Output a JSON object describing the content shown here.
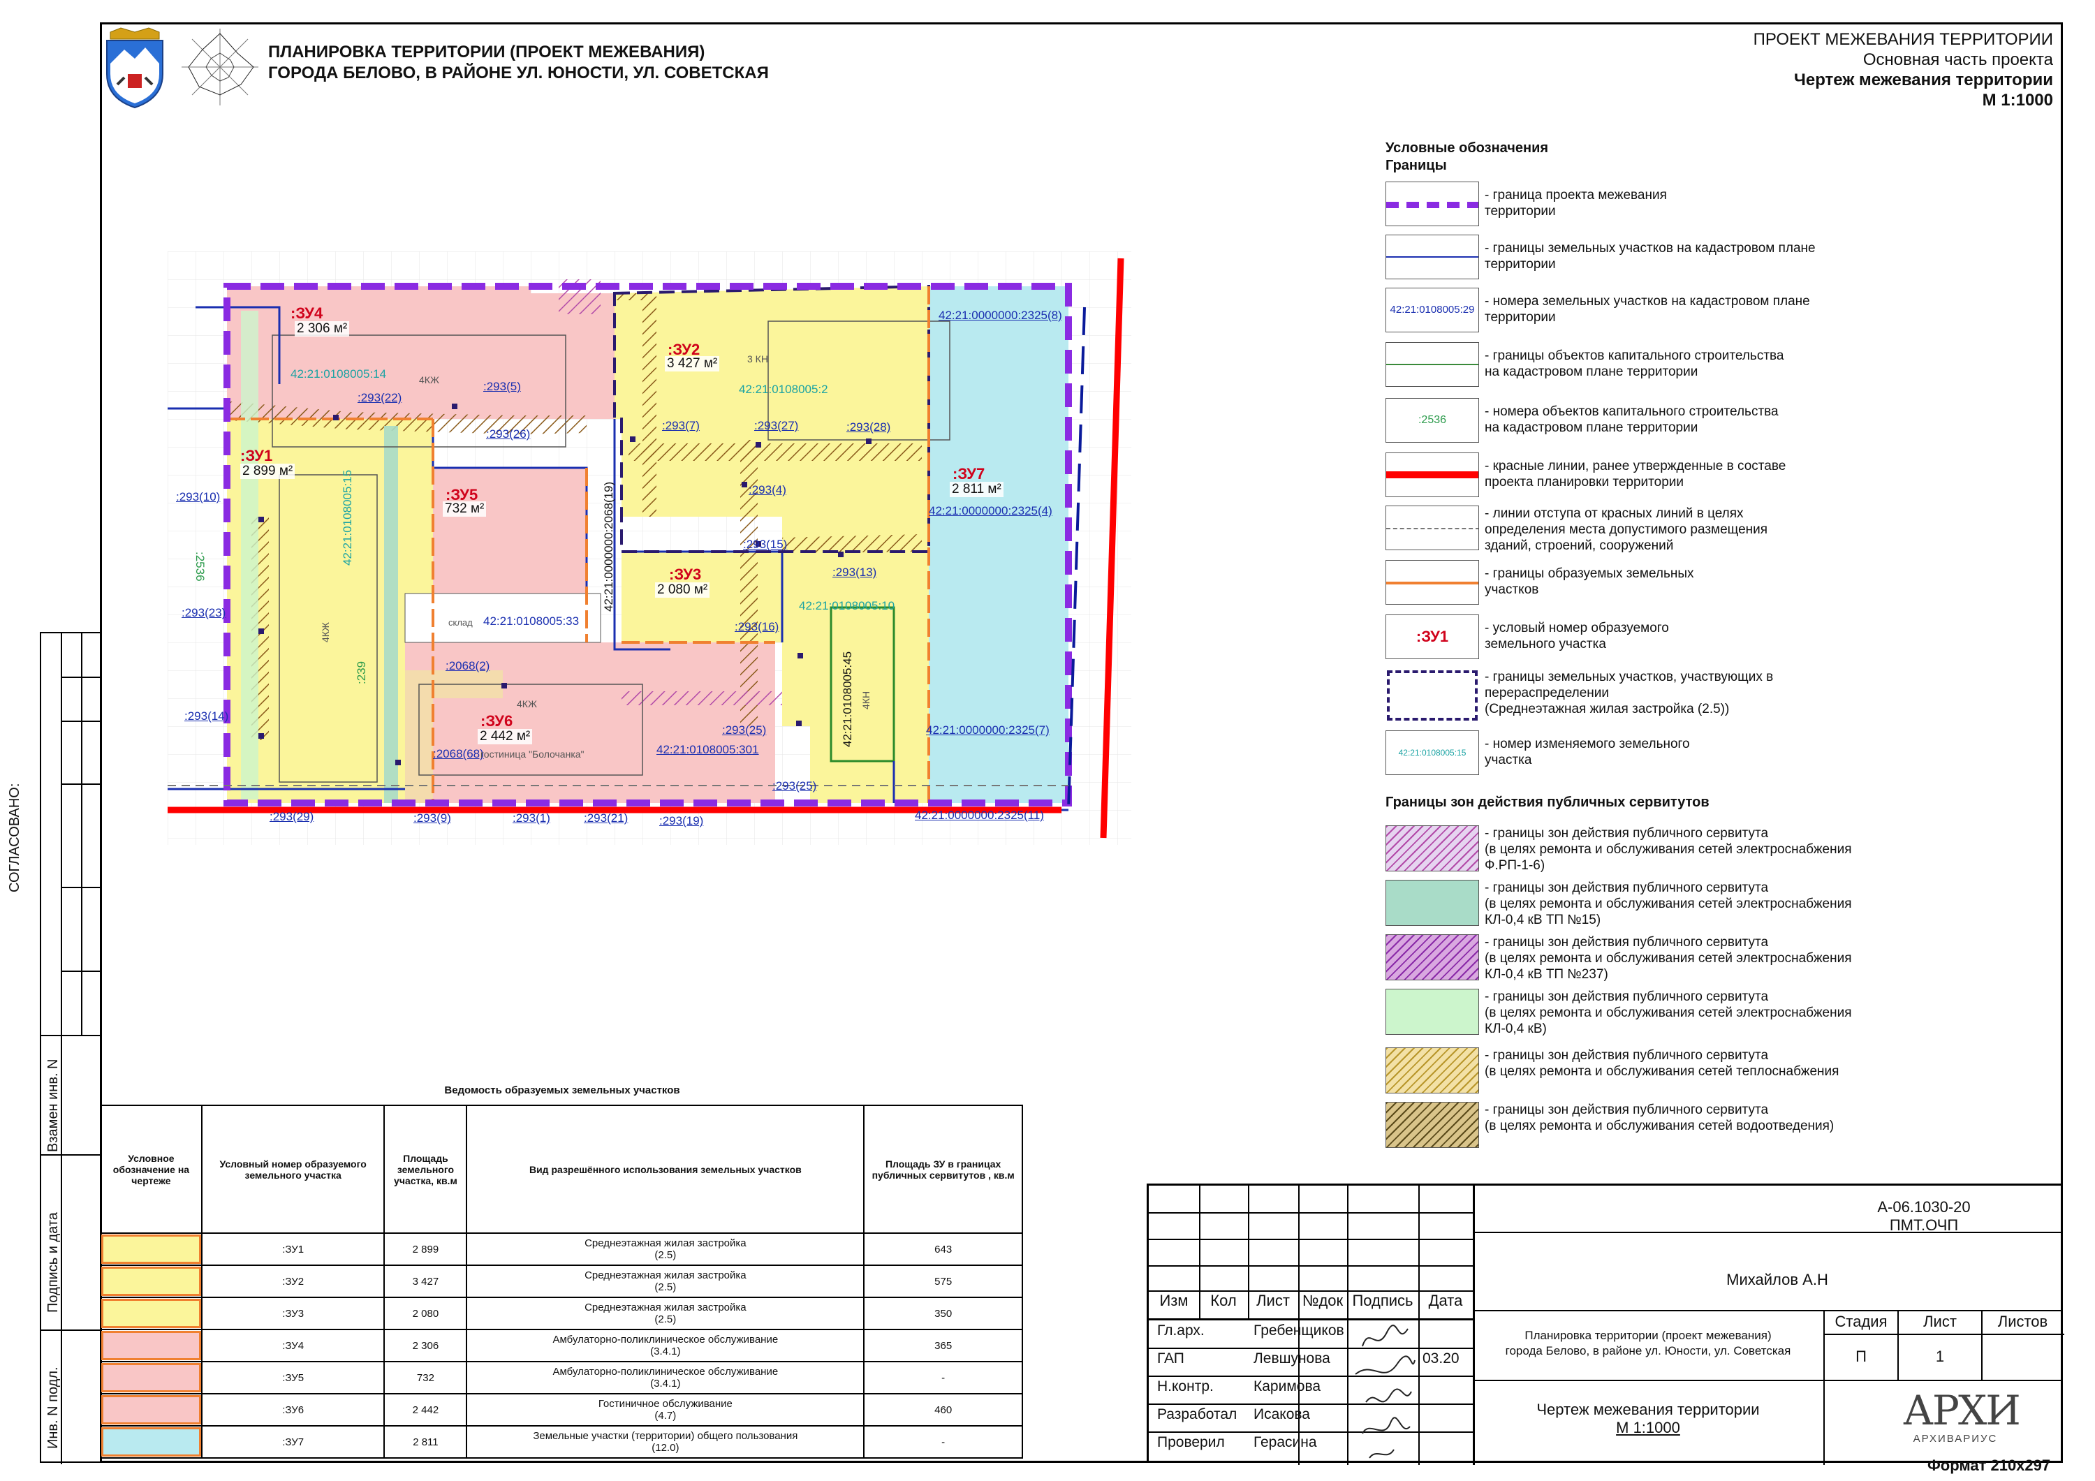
{
  "header": {
    "title_line1": "ПЛАНИРОВКА ТЕРРИТОРИИ (ПРОЕКТ МЕЖЕВАНИЯ)",
    "title_line2": "ГОРОДА БЕЛОВО, В РАЙОНЕ УЛ. ЮНОСТИ, УЛ. СОВЕТСКАЯ"
  },
  "topright": {
    "line1": "ПРОЕКТ МЕЖЕВАНИЯ ТЕРРИТОРИИ",
    "line2": "Основная часть проекта",
    "line3": "Чертеж межевания территории",
    "line4": "М 1:1000"
  },
  "legend": {
    "title1": "Условные обозначения",
    "title2": "Границы",
    "items": [
      {
        "text1": "- граница проекта межевания",
        "text2": "территории"
      },
      {
        "text1": "- границы земельных участков на кадастровом плане",
        "text2": "территории"
      },
      {
        "text1": "- номера земельных участков на кадастровом плане",
        "text2": "территории",
        "sample": "42:21:0108005:29"
      },
      {
        "text1": "- границы объектов капитального строительства",
        "text2": "на кадастровом плане территории"
      },
      {
        "text1": "- номера объектов капитального строительства",
        "text2": "на кадастровом плане территории",
        "sample": ":2536"
      },
      {
        "text1": "- красные линии, ранее утвержденные в составе",
        "text2": "проекта планировки территории"
      },
      {
        "text1": "- линии отступа от красных линий в целях",
        "text2": "определения места допустимого размещения",
        "text3": "зданий, строений, сооружений"
      },
      {
        "text1": " - границы образуемых земельных",
        "text2": " участков"
      },
      {
        "text1": " - условый номер образуемого",
        "text2": " земельного участка",
        "sample": ":ЗУ1"
      },
      {
        "text1": " - границы земельных участков, участвующих в",
        "text2": "перераспределении",
        "text3": "(Среднеэтажная жилая застройка (2.5))"
      },
      {
        "text1": "- номер изменяемого земельного",
        "text2": "участка",
        "sample": "42:21:0108005:15"
      }
    ],
    "servitude_title": "Границы зон действия публичных сервитутов",
    "servitudes": [
      {
        "text1": "- границы зон действия публичного сервитута",
        "text2": "(в целях ремонта и обслуживания сетей электроснабжения",
        "text3": "Ф.РП-1-6)",
        "color": "#e6d4f0"
      },
      {
        "text1": "- границы зон действия публичного сервитута",
        "text2": "(в целях ремонта и обслуживания сетей электроснабжения",
        "text3": "КЛ-0,4 кВ ТП №15)",
        "color": "#a9dcc8"
      },
      {
        "text1": "- границы зон действия публичного сервитута",
        "text2": "(в целях ремонта и обслуживания сетей электроснабжения",
        "text3": "КЛ-0,4 кВ ТП №237)",
        "color": "#d9a8e0"
      },
      {
        "text1": "- границы зон действия публичного сервитута",
        "text2": "(в целях ремонта и обслуживания сетей электроснабжения",
        "text3": "КЛ-0,4 кВ)",
        "color": "#ccf5cc"
      },
      {
        "text1": "- границы зон действия публичного сервитута",
        "text2": "(в целях ремонта и обслуживания сетей теплоснабжения",
        "text3": "",
        "color": "#f3e1a6"
      },
      {
        "text1": "- границы зон действия публичного сервитута",
        "text2": "(в целях ремонта и обслуживания сетей водоотведения)",
        "text3": "",
        "color": "#d9c48a"
      }
    ]
  },
  "map": {
    "zones": [
      {
        "id": ":ЗУ4",
        "area": "2 306 м²"
      },
      {
        "id": ":ЗУ2",
        "area": "3 427 м²"
      },
      {
        "id": ":ЗУ1",
        "area": "2 899 м²"
      },
      {
        "id": ":ЗУ5",
        "area": "732 м²"
      },
      {
        "id": ":ЗУ7",
        "area": "2 811 м²"
      },
      {
        "id": ":ЗУ3",
        "area": "2 080 м²"
      },
      {
        "id": ":ЗУ6",
        "area": "2 442 м²"
      }
    ],
    "cadastral": [
      "42:21:0108005:14",
      "42:21:0108005:2",
      "42:21:0108005:15",
      "42:21:0108005:33",
      "42:21:0108005:10",
      "42:21:0108005:45",
      "42:21:0000000:2068(19)",
      "42:21:0108005:301",
      "42:21:0000000:2325(8)",
      "42:21:0000000:2325(4)",
      "42:21:0000000:2325(7)",
      "42:21:0000000:2325(11)"
    ],
    "servs": [
      ":293(22)",
      ":293(5)",
      ":293(26)",
      ":293(7)",
      ":293(27)",
      ":293(28)",
      ":293(4)",
      ":293(15)",
      ":293(13)",
      ":293(16)",
      ":293(10)",
      ":293(23)",
      ":293(14)",
      ":2068(2)",
      ":2068(68)",
      ":293(25)",
      ":293(25)",
      ":293(29)",
      ":293(9)",
      ":293(1)",
      ":293(21)",
      ":293(19)",
      ":2536",
      ":239"
    ],
    "buildings": [
      "4КЖ",
      "4КЖ",
      "4КЖ",
      "3 КН",
      "4КН",
      "гостиница \"Болочанка\"",
      "склад"
    ]
  },
  "table": {
    "title": "Ведомость образуемых земельных участков",
    "headers": [
      "Условное обозначение на чертеже",
      "Условный номер образуемого земельного участка",
      "Площадь земельного участка, кв.м",
      "Вид разрешённого использования земельных участков",
      "Площадь ЗУ в границах публичных сервитутов , кв.м"
    ],
    "rows": [
      {
        "color": "#fbf59b",
        "num": ":ЗУ1",
        "area": "2 899",
        "use1": "Среднеэтажная жилая застройка",
        "use2": "(2.5)",
        "serv": "643"
      },
      {
        "color": "#fbf59b",
        "num": ":ЗУ2",
        "area": "3 427",
        "use1": "Среднеэтажная жилая застройка",
        "use2": "(2.5)",
        "serv": "575"
      },
      {
        "color": "#fbf59b",
        "num": ":ЗУ3",
        "area": "2 080",
        "use1": "Среднеэтажная жилая застройка",
        "use2": "(2.5)",
        "serv": "350"
      },
      {
        "color": "#f9c6c6",
        "num": ":ЗУ4",
        "area": "2 306",
        "use1": "Амбулаторно-поликлиническое обслуживание",
        "use2": "(3.4.1)",
        "serv": "365"
      },
      {
        "color": "#f9c6c6",
        "num": ":ЗУ5",
        "area": "732",
        "use1": "Амбулаторно-поликлиническое обслуживание",
        "use2": "(3.4.1)",
        "serv": "-"
      },
      {
        "color": "#f9c6c6",
        "num": ":ЗУ6",
        "area": "2 442",
        "use1": "Гостиничное обслуживание",
        "use2": "(4.7)",
        "serv": "460"
      },
      {
        "color": "#b9eaf0",
        "num": ":ЗУ7",
        "area": "2 811",
        "use1": "Земельные участки (территории) общего пользования",
        "use2": "(12.0)",
        "serv": "-"
      }
    ]
  },
  "side": {
    "agreed": "СОГЛАСОВАНО:",
    "inv_replace": "Взамен инв. N",
    "sign_date": "Подпись и дата",
    "inv_orig": "Инв. N подл."
  },
  "stamp": {
    "code": "А-06.1030-20 ПМТ.ОЧП",
    "author": "Михайлов А.Н",
    "cols": [
      "Изм",
      "Кол",
      "Лист",
      "№док",
      "Подпись",
      "Дата"
    ],
    "roles": [
      {
        "role": "Гл.арх.",
        "name": "Гребенщиков",
        "date": ""
      },
      {
        "role": "ГАП",
        "name": "Левшунова",
        "date": "03.20"
      },
      {
        "role": "Н.контр.",
        "name": "Каримова",
        "date": ""
      },
      {
        "role": "Разработал",
        "name": "Исакова",
        "date": ""
      },
      {
        "role": "Проверил",
        "name": "Герасина",
        "date": ""
      }
    ],
    "project_name1": "Планировка территории (проект межевания)",
    "project_name2": "города Белово, в районе ул. Юности, ул. Советская",
    "stage_h": "Стадия",
    "sheet_h": "Лист",
    "sheets_h": "Листов",
    "stage": "П",
    "sheet": "1",
    "sheets": "",
    "drawing1": "Чертеж межевания территории",
    "drawing2": "М 1:1000",
    "logo_big": "АРХИ",
    "logo_small": "АРХИВАРИУС",
    "format": "Формат 210x297"
  }
}
